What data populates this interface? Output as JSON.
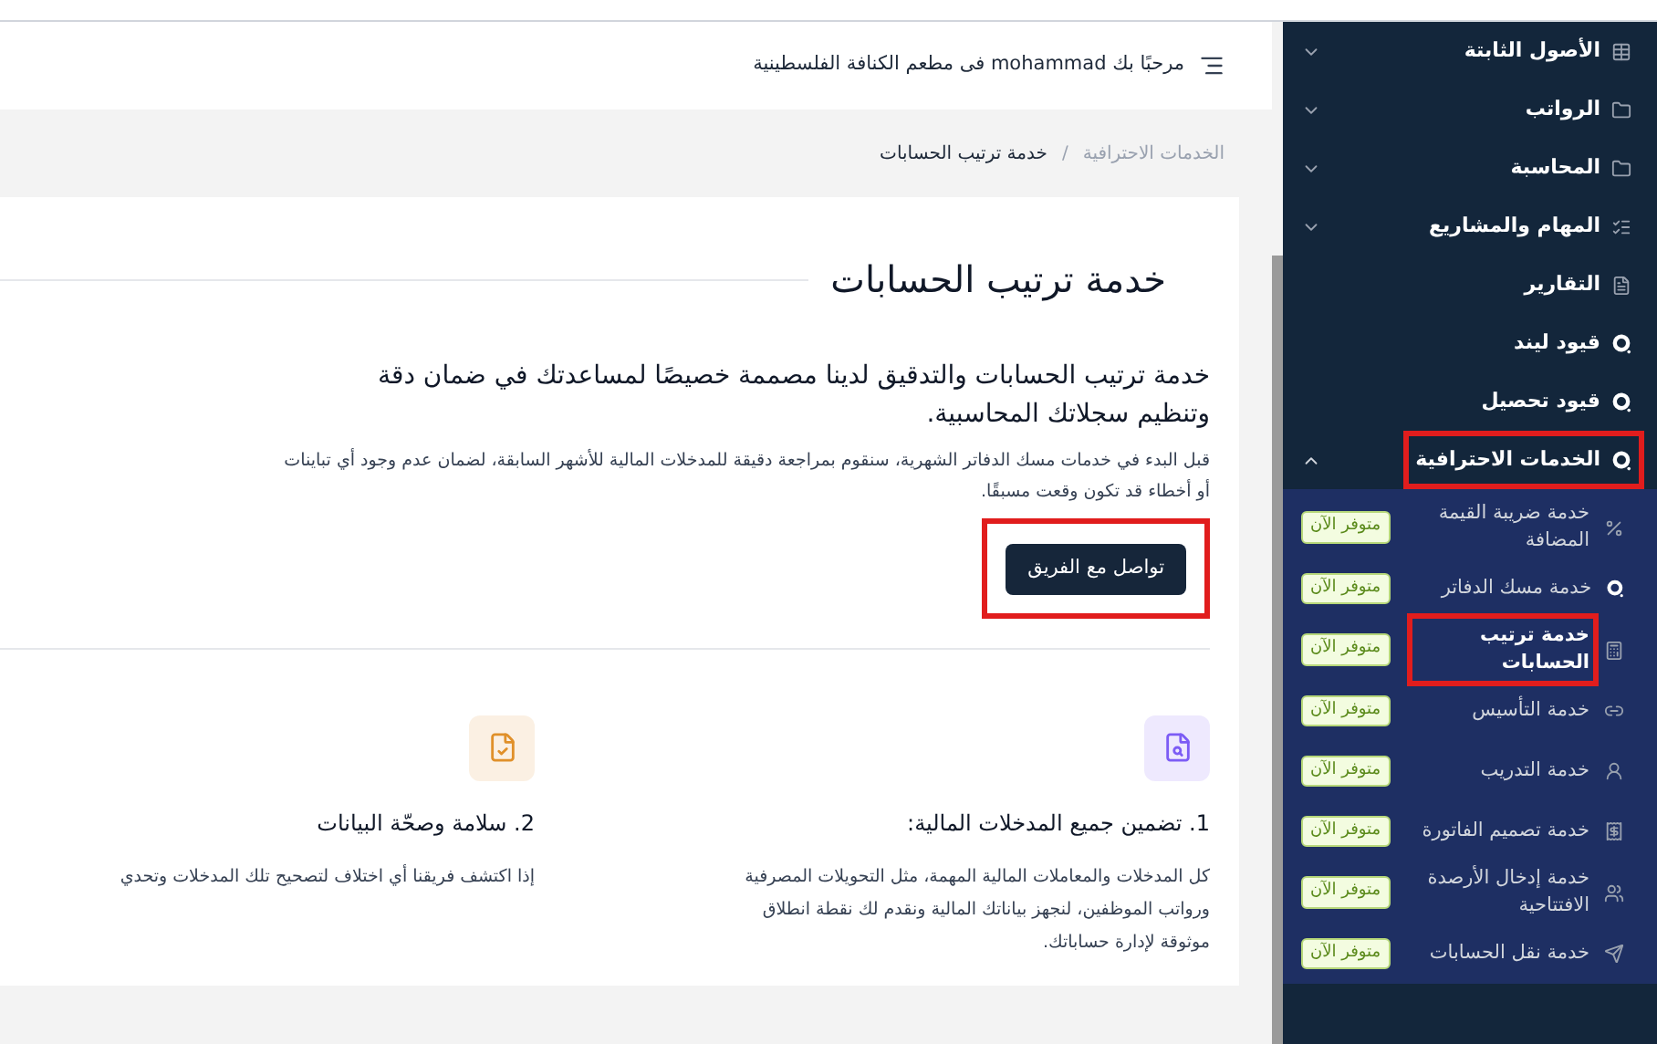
{
  "sidebar": {
    "items": [
      {
        "label": "الأصول الثابتة",
        "expanded": false,
        "highlighted": false
      },
      {
        "label": "الرواتب",
        "expanded": false,
        "highlighted": false
      },
      {
        "label": "المحاسبة",
        "expanded": false,
        "highlighted": false
      },
      {
        "label": "المهام والمشاريع",
        "expanded": false,
        "highlighted": false
      },
      {
        "label": "التقارير",
        "highlighted": false
      },
      {
        "label": "قيود ليند",
        "highlighted": false
      },
      {
        "label": "قيود تحصيل",
        "highlighted": false
      },
      {
        "label": "الخدمات الاحترافية",
        "expanded": true,
        "highlighted": true,
        "children": [
          {
            "label": "خدمة ضريبة القيمة المضافة",
            "badge": "متوفر الآن",
            "selected": false,
            "highlighted": false
          },
          {
            "label": "خدمة مسك الدفاتر",
            "badge": "متوفر الآن",
            "selected": false,
            "highlighted": false
          },
          {
            "label": "خدمة ترتيب الحسابات",
            "badge": "متوفر الآن",
            "selected": true,
            "highlighted": true
          },
          {
            "label": "خدمة التأسيس",
            "badge": "متوفر الآن",
            "selected": false,
            "highlighted": false
          },
          {
            "label": "خدمة التدريب",
            "badge": "متوفر الآن",
            "selected": false,
            "highlighted": false
          },
          {
            "label": "خدمة تصميم الفاتورة",
            "badge": "متوفر الآن",
            "selected": false,
            "highlighted": false
          },
          {
            "label": "خدمة إدخال الأرصدة الافتتاحية",
            "badge": "متوفر الآن",
            "selected": false,
            "highlighted": false
          },
          {
            "label": "خدمة نقل الحسابات",
            "badge": "متوفر الآن",
            "selected": false,
            "highlighted": false
          }
        ]
      }
    ]
  },
  "header": {
    "greeting": "مرحبًا بك mohammad فى مطعم الكنافة الفلسطينية"
  },
  "breadcrumb": [
    "الخدمات الاحترافية",
    "/",
    "خدمة ترتيب الحسابات"
  ],
  "card": {
    "title": "خدمة ترتيب الحسابات",
    "lead": "خدمة ترتيب الحسابات والتدقيق لدينا مصممة خصيصًا لمساعدتك في ضمان دقة وتنظيم سجلاتك المحاسبية.",
    "description": "قبل البدء في خدمات مسك الدفاتر الشهرية، سنقوم بمراجعة دقيقة للمدخلات المالية للأشهر السابقة، لضمان عدم وجود أي تباينات أو أخطاء قد تكون وقعت مسبقًا.",
    "button": {
      "label": "تواصل مع الفريق",
      "highlighted": true
    },
    "features": [
      {
        "title": "1. تضمين جميع المدخلات المالية:",
        "text": "كل المدخلات والمعاملات المالية المهمة، مثل التحويلات المصرفية ورواتب الموظفين، لنجهز بياناتك المالية ونقدم لك نقطة انطلاق موثوقة لإدارة حساباتك.",
        "color": "#7c5cf5"
      },
      {
        "title": "2. سلامة وصحّة البيانات",
        "text": "إذا اكتشف فريقنا أي اختلاف لتصحيح تلك المدخلات وتحدي",
        "color": "#e0902a"
      }
    ]
  }
}
